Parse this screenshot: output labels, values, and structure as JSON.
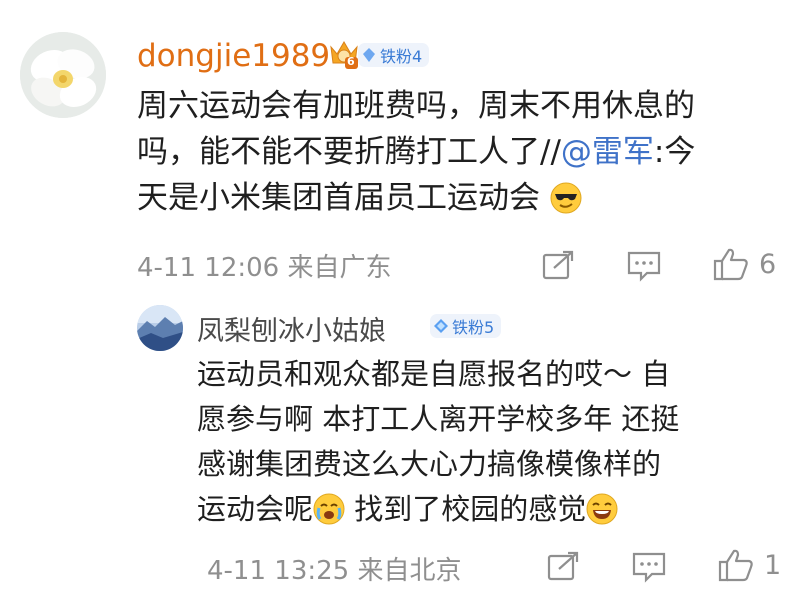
{
  "comment": {
    "username": "dongjie1989",
    "badge_level": "6",
    "badge_label": "铁粉4",
    "content_lines": [
      "周六运动会有加班费吗，周末不用休息的",
      "吗，能不能不要折腾打工人了//"
    ],
    "mention": "@雷军",
    "content_after_mention": ":今",
    "content_line3": "天是小米集团首届员工运动会",
    "emoji_1": "cool-face",
    "meta": "4-11 12:06 来自广东",
    "like_count": "6"
  },
  "reply": {
    "username": "凤梨刨冰小姑娘",
    "badge_label": "铁粉5",
    "content_lines": [
      "运动员和观众都是自愿报名的哎～ 自",
      "愿参与啊 本打工人离开学校多年 还挺",
      "感谢集团费这么大心力搞像模像样的"
    ],
    "content_line4_a": "运动会呢",
    "emoji_1": "crying-face",
    "content_line4_b": " 找到了校园的感觉",
    "emoji_2": "laughing-face",
    "meta": "4-11 13:25 来自北京",
    "like_count": "1"
  },
  "colors": {
    "username": "#e06e14",
    "mention": "#3f72c8",
    "meta": "#8f8f8f",
    "badge_text": "#3a7bd5"
  }
}
